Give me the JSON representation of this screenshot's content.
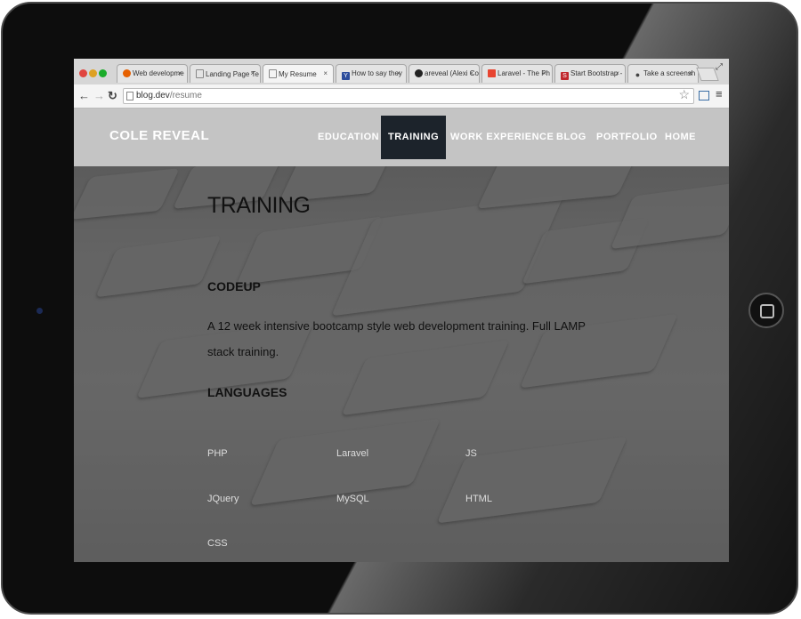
{
  "browser": {
    "tabs": [
      {
        "label": "Web developme",
        "icon": "firefox-icon"
      },
      {
        "label": "Landing Page Te",
        "icon": "page-icon"
      },
      {
        "label": "My Resume",
        "icon": "page-icon"
      },
      {
        "label": "How to say they",
        "icon": "y-icon",
        "fav": "Y"
      },
      {
        "label": "areveal (Alexi Co",
        "icon": "github-icon"
      },
      {
        "label": "Laravel - The Ph",
        "icon": "laravel-icon"
      },
      {
        "label": "Start Bootstrap -",
        "icon": "s-icon",
        "fav": "S"
      },
      {
        "label": "Take a screensh",
        "icon": "apple-icon"
      }
    ],
    "url_host": "blog.dev",
    "url_path": "/resume",
    "tab_close": "×"
  },
  "site": {
    "brand": "COLE REVEAL",
    "nav": [
      "EDUCATION",
      "TRAINING",
      "WORK EXPERIENCE",
      "BLOG",
      "PORTFOLIO",
      "HOME"
    ],
    "active_nav": "TRAINING"
  },
  "content": {
    "heading": "TRAINING",
    "program": "CODEUP",
    "description": "A 12 week intensive bootcamp style web development training. Full LAMP stack training.",
    "languages_heading": "LANGUAGES",
    "languages": [
      "PHP",
      "Laravel",
      "JS",
      "JQuery",
      "MySQL",
      "HTML",
      "CSS"
    ]
  },
  "colors": {
    "nav_active_bg": "#1c232b",
    "traffic_red": "#e0443e",
    "traffic_yellow": "#dea123",
    "traffic_green": "#1aab29"
  }
}
